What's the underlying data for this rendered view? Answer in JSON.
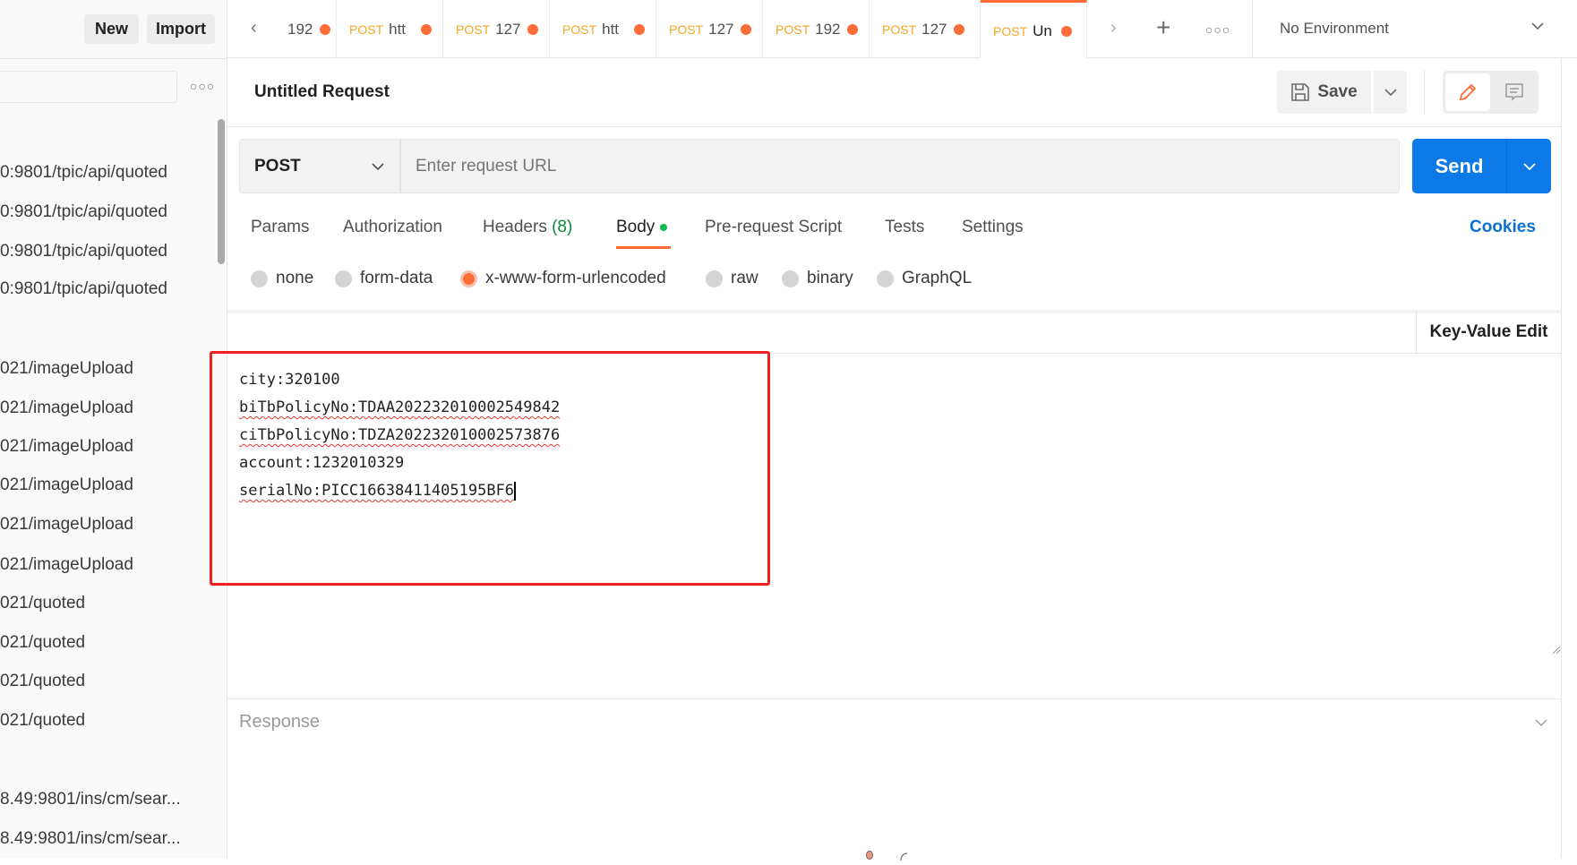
{
  "sidebar": {
    "new_label": "New",
    "import_label": "Import",
    "items": [
      "0:9801/tpic/api/quoted",
      "0:9801/tpic/api/quoted",
      "0:9801/tpic/api/quoted",
      "0:9801/tpic/api/quoted",
      "021/imageUpload",
      "021/imageUpload",
      "021/imageUpload",
      "021/imageUpload",
      "021/imageUpload",
      "021/imageUpload",
      "021/quoted",
      "021/quoted",
      "021/quoted",
      "021/quoted",
      "8.49:9801/ins/cm/sear...",
      "8.49:9801/ins/cm/sear..."
    ]
  },
  "tabs": [
    {
      "method": "",
      "url": "192"
    },
    {
      "method": "POST",
      "url": "htt"
    },
    {
      "method": "POST",
      "url": "127"
    },
    {
      "method": "POST",
      "url": "htt"
    },
    {
      "method": "POST",
      "url": "127"
    },
    {
      "method": "POST",
      "url": "192"
    },
    {
      "method": "POST",
      "url": "127"
    },
    {
      "method": "POST",
      "url": "Un"
    }
  ],
  "environment": "No Environment",
  "request": {
    "title": "Untitled Request",
    "save_label": "Save",
    "method": "POST",
    "url_placeholder": "Enter request URL",
    "send_label": "Send"
  },
  "request_tabs": {
    "params": "Params",
    "authorization": "Authorization",
    "headers": "Headers",
    "headers_count": "(8)",
    "body": "Body",
    "prerequest": "Pre-request Script",
    "tests": "Tests",
    "settings": "Settings",
    "cookies": "Cookies"
  },
  "body_types": [
    "none",
    "form-data",
    "x-www-form-urlencoded",
    "raw",
    "binary",
    "GraphQL"
  ],
  "body_type_selected": "x-www-form-urlencoded",
  "key_value_edit": "Key-Value Edit",
  "bulk_lines": [
    "city:320100",
    "biTbPolicyNo:TDAA202232010002549842",
    "ciTbPolicyNo:TDZA202232010002573876",
    "account:1232010329",
    "serialNo:PICC16638411405195BF6"
  ],
  "response_label": "Response",
  "colors": {
    "accent": "#ff6c37",
    "send": "#0b7ae8",
    "highlight_box": "#f02020",
    "method": "#f5a623"
  }
}
